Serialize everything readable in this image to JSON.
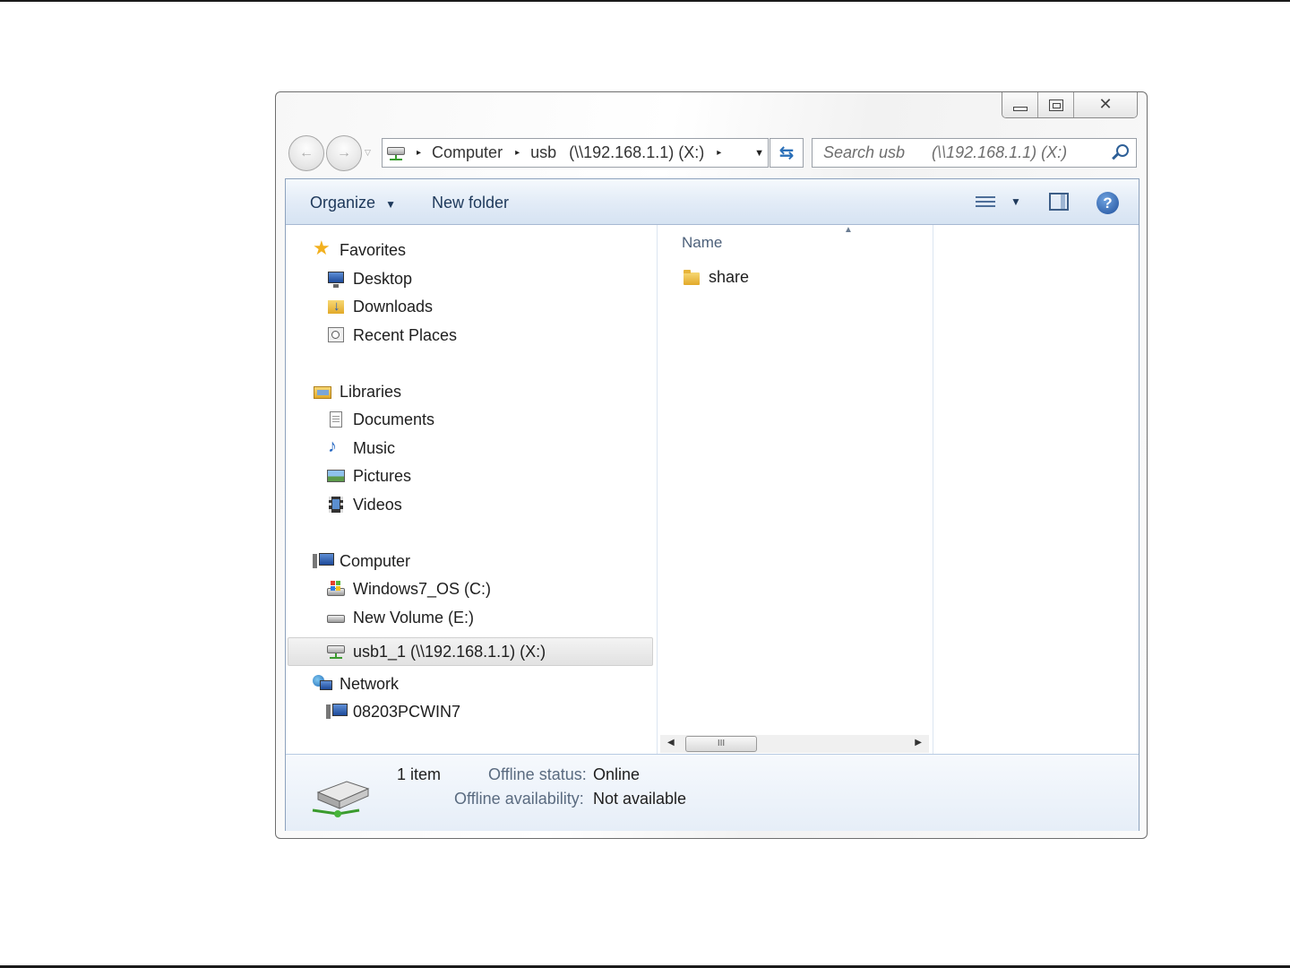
{
  "window": {
    "caption": {
      "minimize_icon": "minimize-icon",
      "restore_icon": "maximize-icon",
      "close_glyph": "✕"
    },
    "address": {
      "crumbs": [
        "Computer",
        "usb",
        "(\\\\192.168.1.1) (X:)"
      ],
      "separator": "▸"
    },
    "search": {
      "placeholder": "Search usb      (\\\\192.168.1.1) (X:)"
    },
    "toolbar": {
      "organize": "Organize",
      "new_folder": "New folder"
    }
  },
  "nav": {
    "favorites": {
      "label": "Favorites",
      "items": [
        "Desktop",
        "Downloads",
        "Recent Places"
      ]
    },
    "libraries": {
      "label": "Libraries",
      "items": [
        "Documents",
        "Music",
        "Pictures",
        "Videos"
      ]
    },
    "computer": {
      "label": "Computer",
      "items": [
        "Windows7_OS (C:)",
        "New Volume (E:)",
        "usb1_1 (\\\\192.168.1.1) (X:)"
      ]
    },
    "network": {
      "label": "Network",
      "items": [
        "08203PCWIN7"
      ]
    }
  },
  "filelist": {
    "column": "Name",
    "files": [
      {
        "name": "share",
        "type": "folder"
      }
    ],
    "scroll_thumb": "III"
  },
  "details": {
    "count": "1 item",
    "offline_status_label": "Offline status:",
    "offline_status_value": "Online",
    "offline_availability_label": "Offline availability:",
    "offline_availability_value": "Not available"
  }
}
